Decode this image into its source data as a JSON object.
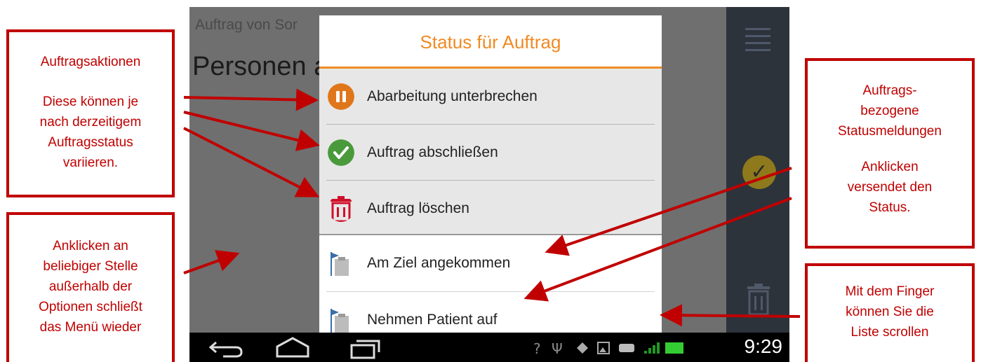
{
  "background": {
    "title": "Auftrag von Sor",
    "heading": "Personen a"
  },
  "dialog": {
    "title": "Status für Auftrag",
    "actions": [
      {
        "label": "Abarbeitung unterbrechen",
        "icon": "pause-icon",
        "color": "#e0761a"
      },
      {
        "label": "Auftrag abschließen",
        "icon": "check-icon",
        "color": "#4a9a3c"
      },
      {
        "label": "Auftrag löschen",
        "icon": "trash-icon",
        "color": "#d0102a"
      }
    ],
    "statuses": [
      {
        "label": "Am Ziel angekommen",
        "icon": "flag-clipboard-icon"
      },
      {
        "label": "Nehmen Patient auf",
        "icon": "flag-clipboard-icon"
      }
    ]
  },
  "statusbar": {
    "time": "9:29"
  },
  "callouts": {
    "actions": {
      "title": "Auftragsaktionen",
      "body": [
        "Diese können je",
        "nach derzeitigem",
        "Auftragsstatus",
        "variieren."
      ]
    },
    "close": {
      "body": [
        "Anklicken an",
        "beliebiger Stelle",
        "außerhalb der",
        "Optionen schließt",
        "das Menü wieder"
      ]
    },
    "status": {
      "title": [
        "Auftrags-",
        "bezogene",
        "Statusmeldungen"
      ],
      "body": [
        "Anklicken",
        "versendet den",
        "Status."
      ]
    },
    "scroll": {
      "body": [
        "Mit dem Finger",
        "können Sie die",
        "Liste scrollen"
      ]
    }
  },
  "colors": {
    "accent": "#f08a24",
    "callout": "#c00000"
  }
}
